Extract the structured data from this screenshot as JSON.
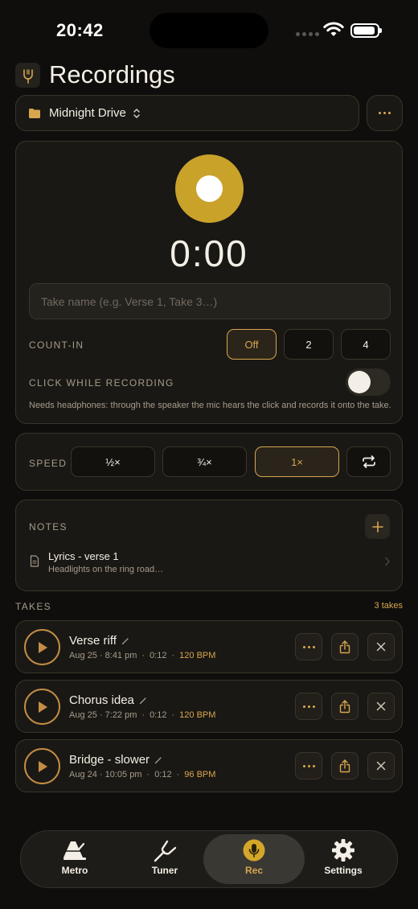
{
  "status": {
    "time": "20:42"
  },
  "header": {
    "title": "Recordings",
    "logo_icon": "tuning-fork-logo-icon"
  },
  "project": {
    "name": "Midnight Drive",
    "icon": "folder-icon"
  },
  "recorder": {
    "timer": "0:00",
    "take_name_placeholder": "Take name (e.g. Verse 1, Take 3…)",
    "take_name_value": "",
    "count_in": {
      "label": "COUNT-IN",
      "options": [
        "Off",
        "2",
        "4"
      ],
      "selected": "Off"
    },
    "click_while_recording": {
      "label": "CLICK WHILE RECORDING",
      "enabled": false
    },
    "hint": "Needs headphones: through the speaker the mic hears the click and records it onto the take."
  },
  "speed": {
    "label": "SPEED",
    "options": [
      "½×",
      "¾×",
      "1×"
    ],
    "selected": "1×"
  },
  "notes": {
    "label": "NOTES",
    "items": [
      {
        "title": "Lyrics - verse 1",
        "preview": "Headlights on the ring road…"
      }
    ]
  },
  "takes": {
    "label": "TAKES",
    "count": "3 takes",
    "items": [
      {
        "title": "Verse riff",
        "date": "Aug 25 · 8:41 pm",
        "duration": "0:12",
        "bpm": "120 BPM"
      },
      {
        "title": "Chorus idea",
        "date": "Aug 25 · 7:22 pm",
        "duration": "0:12",
        "bpm": "120 BPM"
      },
      {
        "title": "Bridge - slower",
        "date": "Aug 24 · 10:05 pm",
        "duration": "0:12",
        "bpm": "96 BPM"
      }
    ]
  },
  "tabbar": {
    "tabs": [
      {
        "label": "Metro",
        "icon": "metronome-icon"
      },
      {
        "label": "Tuner",
        "icon": "tuning-fork-icon"
      },
      {
        "label": "Rec",
        "icon": "microphone-icon"
      },
      {
        "label": "Settings",
        "icon": "gear-icon"
      }
    ],
    "active": "Rec"
  },
  "colors": {
    "accent": "#d7a64f",
    "record": "#c9a22a",
    "background": "#0f0e0c",
    "card": "#1a1814"
  }
}
